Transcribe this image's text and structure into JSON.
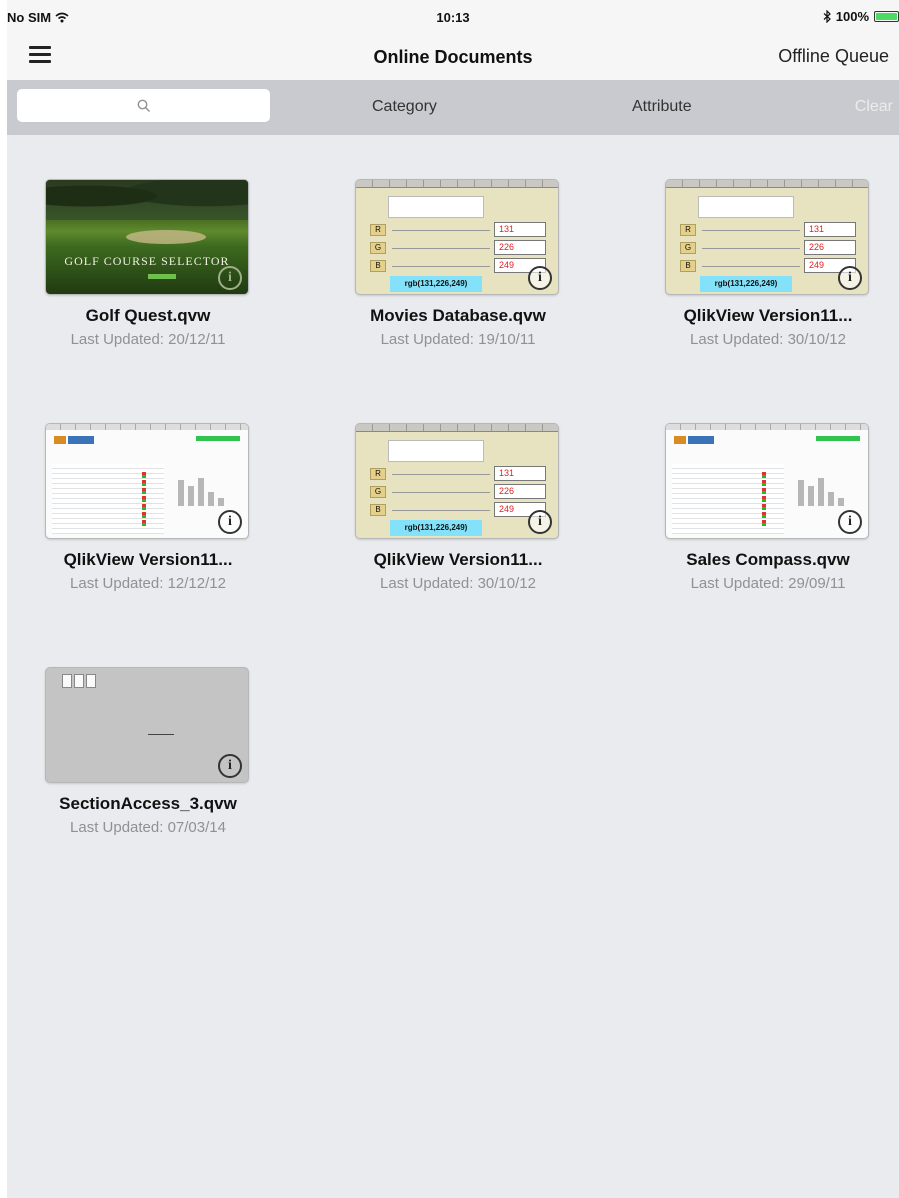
{
  "status_bar": {
    "carrier": "No SIM",
    "time": "10:13",
    "battery": "100%"
  },
  "nav": {
    "title": "Online Documents",
    "offline_queue": "Offline Queue"
  },
  "filter": {
    "search_placeholder": "",
    "category": "Category",
    "attribute": "Attribute",
    "clear": "Clear"
  },
  "documents": [
    {
      "title": "Golf Quest.qvw",
      "updated": "Last Updated: 20/12/11",
      "thumb": "golf",
      "thumb_text": "GOLF COURSE SELECTOR"
    },
    {
      "title": "Movies Database.qvw",
      "updated": "Last Updated: 19/10/11",
      "thumb": "rgb",
      "thumb_text": "rgb(131,226,249)"
    },
    {
      "title": "QlikView Version11...",
      "updated": "Last Updated: 30/10/12",
      "thumb": "rgb",
      "thumb_text": "rgb(131,226,249)"
    },
    {
      "title": "QlikView Version11...",
      "updated": "Last Updated: 12/12/12",
      "thumb": "pipeline"
    },
    {
      "title": "QlikView Version11...",
      "updated": "Last Updated: 30/10/12",
      "thumb": "rgb",
      "thumb_text": "rgb(131,226,249)"
    },
    {
      "title": "Sales Compass.qvw",
      "updated": "Last Updated: 29/09/11",
      "thumb": "pipeline"
    },
    {
      "title": "SectionAccess_3.qvw",
      "updated": "Last Updated: 07/03/14",
      "thumb": "section"
    }
  ],
  "icons": {
    "menu": "hamburger-icon",
    "search": "search-icon",
    "info": "info-icon",
    "wifi": "wifi-icon",
    "bluetooth": "bluetooth-icon",
    "battery": "battery-icon"
  },
  "colors": {
    "background": "#e9ebee",
    "filter_bar": "#c8cacf",
    "nav_bar": "#f6f6f6",
    "battery_fill": "#4cd964",
    "date_text": "#8e9196"
  }
}
